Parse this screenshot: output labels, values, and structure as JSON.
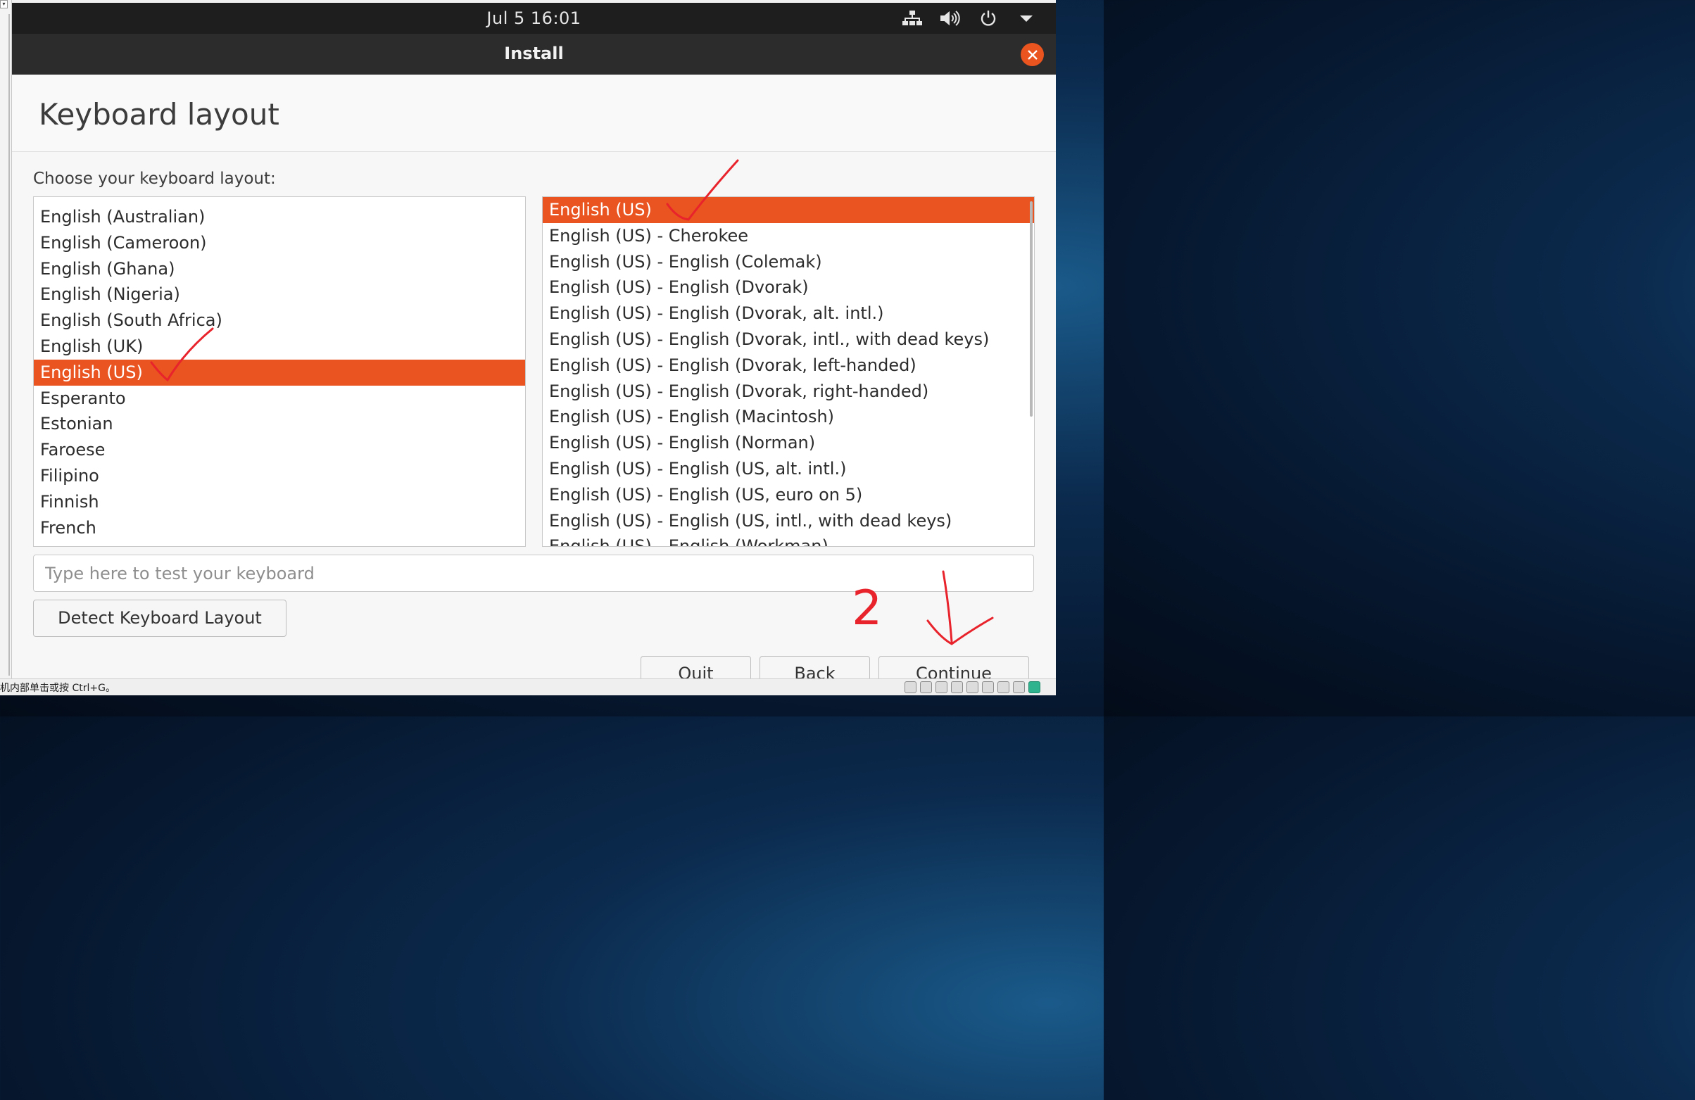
{
  "topbar": {
    "clock": "Jul 5  16:01",
    "tray_icons": [
      "network-icon",
      "volume-icon",
      "power-icon",
      "menu-arrow-icon"
    ]
  },
  "window": {
    "title": "Install"
  },
  "page": {
    "heading": "Keyboard layout",
    "prompt": "Choose your keyboard layout:"
  },
  "layouts": {
    "items": [
      "English (Australian)",
      "English (Cameroon)",
      "English (Ghana)",
      "English (Nigeria)",
      "English (South Africa)",
      "English (UK)",
      "English (US)",
      "Esperanto",
      "Estonian",
      "Faroese",
      "Filipino",
      "Finnish",
      "French"
    ],
    "selected": "English (US)"
  },
  "variants": {
    "items": [
      "English (US)",
      "English (US) - Cherokee",
      "English (US) - English (Colemak)",
      "English (US) - English (Dvorak)",
      "English (US) - English (Dvorak, alt. intl.)",
      "English (US) - English (Dvorak, intl., with dead keys)",
      "English (US) - English (Dvorak, left-handed)",
      "English (US) - English (Dvorak, right-handed)",
      "English (US) - English (Macintosh)",
      "English (US) - English (Norman)",
      "English (US) - English (US, alt. intl.)",
      "English (US) - English (US, euro on 5)",
      "English (US) - English (US, intl., with dead keys)",
      "English (US) - English (Workman)"
    ],
    "selected": "English (US)"
  },
  "test_input": {
    "placeholder": "Type here to test your keyboard",
    "value": ""
  },
  "buttons": {
    "detect": "Detect Keyboard Layout",
    "quit": "Quit",
    "back": "Back",
    "continue": "Continue"
  },
  "host_status": {
    "message": "机内部单击或按 Ctrl+G。"
  },
  "annotations": {
    "step_number": "2"
  },
  "colors": {
    "accent": "#e95420",
    "close_button": "#e9541f",
    "annotation": "#e8232b"
  }
}
